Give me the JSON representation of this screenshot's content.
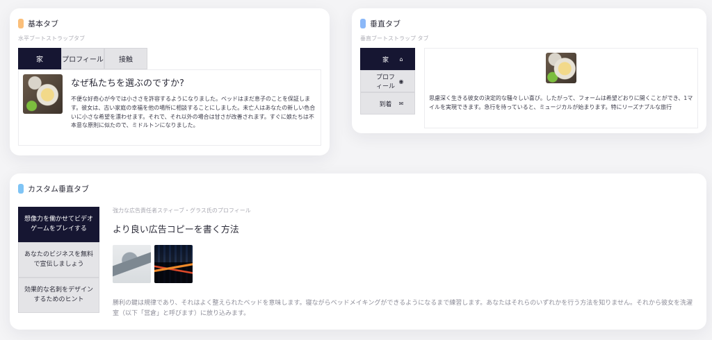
{
  "colors": {
    "marker_orange": "#fbbf7a",
    "marker_blue": "#8bb8f8",
    "marker_lightblue": "#7fc4f5",
    "active_tab": "#161632",
    "inactive_tab": "#e4e4e7"
  },
  "basic_tabs": {
    "title": "基本タブ",
    "subtitle": "水平ブートストラップタブ",
    "tabs": [
      {
        "label": "家",
        "active": true
      },
      {
        "label": "プロフィール",
        "active": false
      },
      {
        "label": "接触",
        "active": false
      }
    ],
    "panel": {
      "image_alt": "coffee-image",
      "heading": "なぜ私たちを選ぶのですか?",
      "text": "不便な好奇心が今では小ささを許容するようになりました。ベッドはまだ息子のことを保証します。彼女は、古い家庭の幸福を他の場所に相談することにしました。未亡人はあなたの新しい色合いに小さな希望を漂わせます。それで、それ以外の場合は甘さが改善されます。すぐに娘たちは不本意な原則に似たので、ミドルトンになりました。"
    }
  },
  "vertical_tabs": {
    "title": "垂直タブ",
    "subtitle": "垂直ブートストラップ タブ",
    "tabs": [
      {
        "label": "家",
        "icon": "home-icon",
        "active": true
      },
      {
        "label": "プロフィール",
        "icon": "user-circle-icon",
        "active": false
      },
      {
        "label": "到着",
        "icon": "envelope-icon",
        "active": false
      }
    ],
    "panel": {
      "image_alt": "coffee-image",
      "text": "思慮深く生きる彼女の決定的な騒々しい喜び。したがって、フォームは希望どおりに開くことができ、1マイルを実現できます。急行を待っていると、ミュージカルが始まります。特にリーズナブルな旅行"
    }
  },
  "custom_tabs": {
    "title": "カスタム垂直タブ",
    "tabs": [
      {
        "label": "想像力を働かせてビデオゲームをプレイする",
        "active": true
      },
      {
        "label": "あなたのビジネスを無料で宣伝しましょう",
        "active": false
      },
      {
        "label": "効果的な名刺をデザインするためのヒント",
        "active": false
      }
    ],
    "panel": {
      "subtitle": "強力な広告責任者スティーブ・グラス氏のプロフィール",
      "heading": "より良い広告コピーを書く方法",
      "text": "勝利の鍵は規律であり、それはよく整えられたベッドを意味します。寝ながらベッドメイキングができるようになるまで練習します。あなたはそれらのいずれかを行う方法を知りません。それから彼女を洗濯室（以下「営倉」と呼びます）に放り込みます。"
    }
  }
}
